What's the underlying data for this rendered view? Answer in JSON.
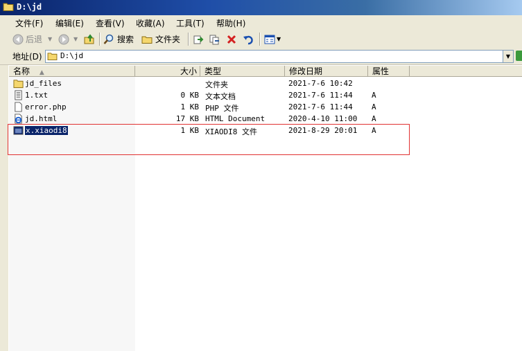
{
  "window": {
    "title": "D:\\jd"
  },
  "menu": [
    {
      "label": "文件(F)"
    },
    {
      "label": "编辑(E)"
    },
    {
      "label": "查看(V)"
    },
    {
      "label": "收藏(A)"
    },
    {
      "label": "工具(T)"
    },
    {
      "label": "帮助(H)"
    }
  ],
  "toolbar": {
    "back_label": "后退",
    "search_label": "搜索",
    "folders_label": "文件夹"
  },
  "address": {
    "label": "地址(D)",
    "value": "D:\\jd"
  },
  "columns": {
    "name": "名称",
    "size": "大小",
    "type": "类型",
    "date": "修改日期",
    "attr": "属性"
  },
  "files": [
    {
      "name": "jd_files",
      "size": "",
      "type": "文件夹",
      "date": "2021-7-6 10:42",
      "attr": "",
      "icon": "folder-icon"
    },
    {
      "name": "1.txt",
      "size": "0 KB",
      "type": "文本文档",
      "date": "2021-7-6 11:44",
      "attr": "A",
      "icon": "text-file-icon"
    },
    {
      "name": "error.php",
      "size": "1 KB",
      "type": "PHP 文件",
      "date": "2021-7-6 11:44",
      "attr": "A",
      "icon": "file-icon"
    },
    {
      "name": "jd.html",
      "size": "17 KB",
      "type": "HTML Document",
      "date": "2020-4-10 11:00",
      "attr": "A",
      "icon": "ie-document-icon"
    },
    {
      "name": "x.xiaodi8",
      "size": "1 KB",
      "type": "XIAODI8 文件",
      "date": "2021-8-29 20:01",
      "attr": "A",
      "icon": "unknown-file-icon",
      "selected": true
    }
  ],
  "colors": {
    "titlebar": "#0a246a",
    "selection": "#0a246a",
    "highlight_box": "#e03030",
    "chrome": "#ece9d8"
  }
}
